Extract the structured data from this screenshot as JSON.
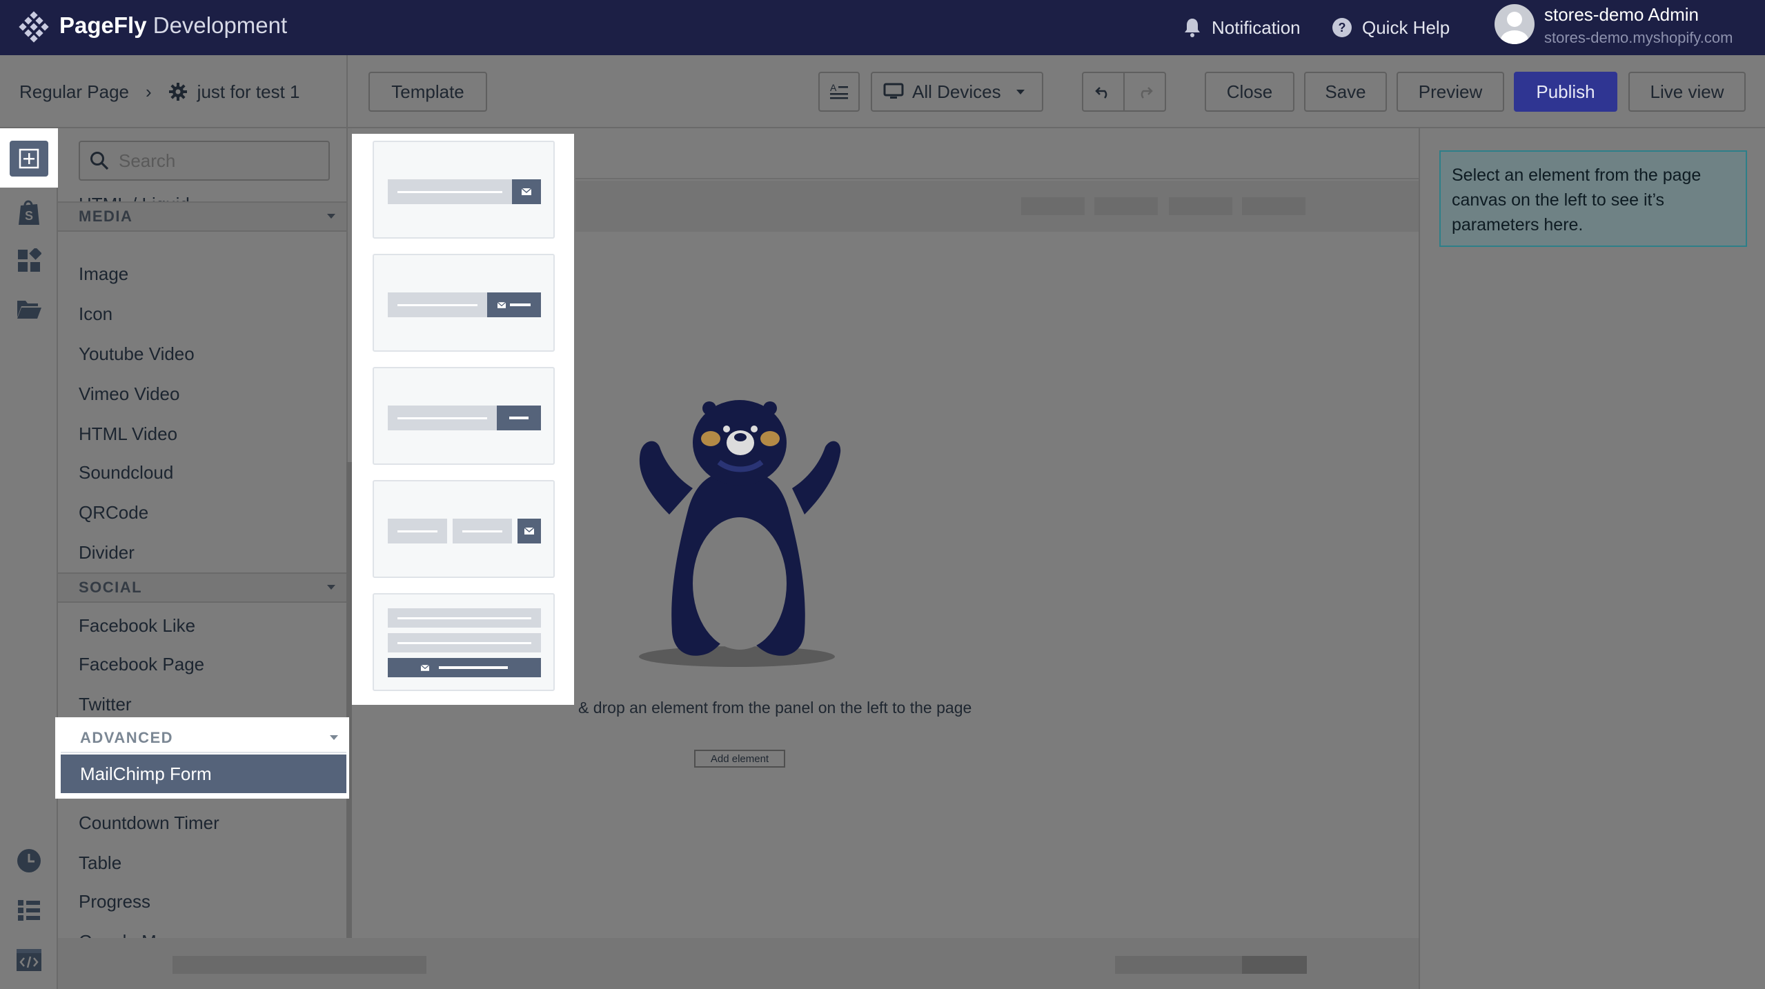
{
  "app": {
    "brand_bold": "PageFly",
    "brand_light": "Development"
  },
  "header": {
    "notification_label": "Notification",
    "quick_help_label": "Quick Help",
    "user_name": "stores-demo Admin",
    "user_store": "stores-demo.myshopify.com"
  },
  "breadcrumb": {
    "page_type": "Regular Page",
    "page_name": "just for test 1"
  },
  "toolbar": {
    "template_label": "Template",
    "device_label": "All Devices",
    "close_label": "Close",
    "save_label": "Save",
    "preview_label": "Preview",
    "publish_label": "Publish",
    "live_view_label": "Live view"
  },
  "panel": {
    "search_placeholder": "Search",
    "partial_item": "HTML / Liquid",
    "media_header": "MEDIA",
    "media_items": [
      "Image",
      "Icon",
      "Youtube Video",
      "Vimeo Video",
      "HTML Video",
      "Soundcloud",
      "QRCode",
      "Divider"
    ],
    "social_header": "SOCIAL",
    "social_items": [
      "Facebook Like",
      "Facebook Page",
      "Twitter"
    ],
    "advanced_header": "ADVANCED",
    "advanced_selected": "MailChimp Form",
    "advanced_items": [
      "Countdown Timer",
      "Table",
      "Progress",
      "Google Map"
    ]
  },
  "canvas": {
    "drop_text": "& drop an element from the panel on the left to the page",
    "add_element_label": "Add element"
  },
  "inspector": {
    "empty_message": "Select an element from the page canvas on the left to see it’s parameters here."
  },
  "colors": {
    "topbar": "#1c1f45",
    "publish": "#2f3592",
    "selected_item": "#55637a",
    "info_border": "#2d7f89",
    "bear": "#141a45"
  }
}
